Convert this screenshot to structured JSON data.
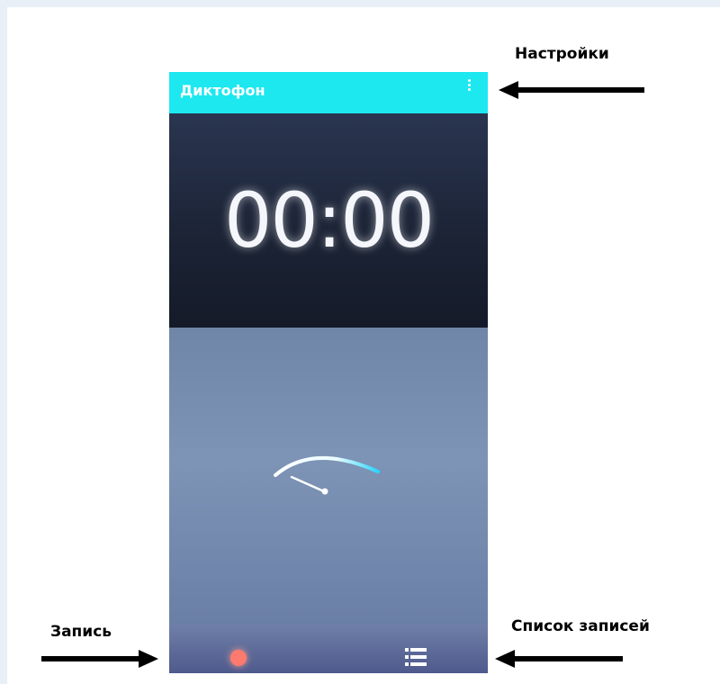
{
  "annotations": {
    "settings": "Настройки",
    "record": "Запись",
    "recordings_list": "Список записей"
  },
  "app": {
    "title": "Диктофон",
    "menu_icon": "more-vert-icon"
  },
  "timer": {
    "value": "00:00"
  },
  "level_meter": {
    "icon": "level-gauge",
    "level": 0.2
  },
  "bottom_bar": {
    "record_icon": "record-dot-icon",
    "list_icon": "list-icon"
  },
  "colors": {
    "appbar": "#1de8f0",
    "record": "#ff7a6e",
    "arrow": "#000000"
  }
}
